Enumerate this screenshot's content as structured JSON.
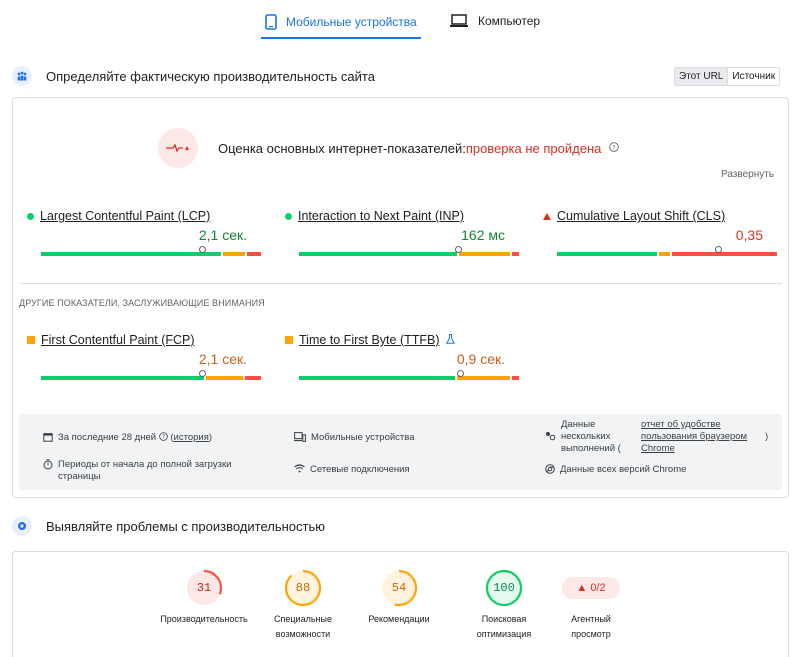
{
  "tabs": {
    "mobile": "Мобильные устройства",
    "desktop": "Компьютер"
  },
  "field": {
    "heading": "Определяйте фактическую производительность сайта",
    "toggle": {
      "url": "Этот URL",
      "origin": "Источник"
    },
    "assessment": {
      "label": "Оценка основных интернет-показателей:",
      "status": "проверка не пройдена",
      "help": "?"
    },
    "expand": "Развернуть",
    "core_metrics": [
      {
        "name": "Largest Contentful Paint (LCP)",
        "value": "2,1 сек.",
        "status": "good",
        "distribution": [
          0.82,
          0.11,
          0.07
        ],
        "marker": 0.72
      },
      {
        "name": "Interaction to Next Paint (INP)",
        "value": "162 мс",
        "status": "good",
        "distribution": [
          0.72,
          0.24,
          0.04
        ],
        "marker": 0.71
      },
      {
        "name": "Cumulative Layout Shift (CLS)",
        "value": "0,35",
        "status": "poor",
        "distribution": [
          0.46,
          0.06,
          0.48
        ],
        "marker": 0.72
      }
    ],
    "other_title": "ДРУГИЕ ПОКАЗАТЕЛИ, ЗАСЛУЖИВАЮЩИЕ ВНИМАНИЯ",
    "other_metrics": [
      {
        "name": "First Contentful Paint (FCP)",
        "value": "2,1 сек.",
        "status": "average",
        "distribution": [
          0.74,
          0.18,
          0.08
        ],
        "marker": 0.72
      },
      {
        "name": "Time to First Byte (TTFB)",
        "value": "0,9 сек.",
        "status": "average",
        "distribution": [
          0.71,
          0.25,
          0.04
        ],
        "marker": 0.72
      }
    ],
    "info": {
      "period_prefix": "За последние 28 дней",
      "period_help": "?",
      "history_link": "история",
      "device": "Мобильные устройства",
      "samples_text": "Данные нескольких выполнений (",
      "samples_link": "отчет об удобстве пользования браузером Chrome",
      "samples_suffix": ")",
      "duration": "Периоды от начала до полной загрузки страницы",
      "network": "Сетевые подключения",
      "chrome_versions": "Данные всех версий Chrome"
    }
  },
  "lab": {
    "heading": "Выявляйте проблемы с производительностью",
    "scores": [
      {
        "label": "Производительность",
        "score": 31,
        "status": "poor"
      },
      {
        "label": "Специальные возможности",
        "score": 88,
        "status": "average"
      },
      {
        "label": "Рекомендации",
        "score": 54,
        "status": "average"
      },
      {
        "label": "Поисковая оптимизация",
        "score": 100,
        "status": "good"
      }
    ],
    "agent": {
      "badge": "▲ 0/2",
      "label": "Агентный просмотр"
    }
  },
  "colors": {
    "good": "#0cce6b",
    "average": "#ffa400",
    "poor": "#ff4e42",
    "accent": "#1a73e8"
  }
}
